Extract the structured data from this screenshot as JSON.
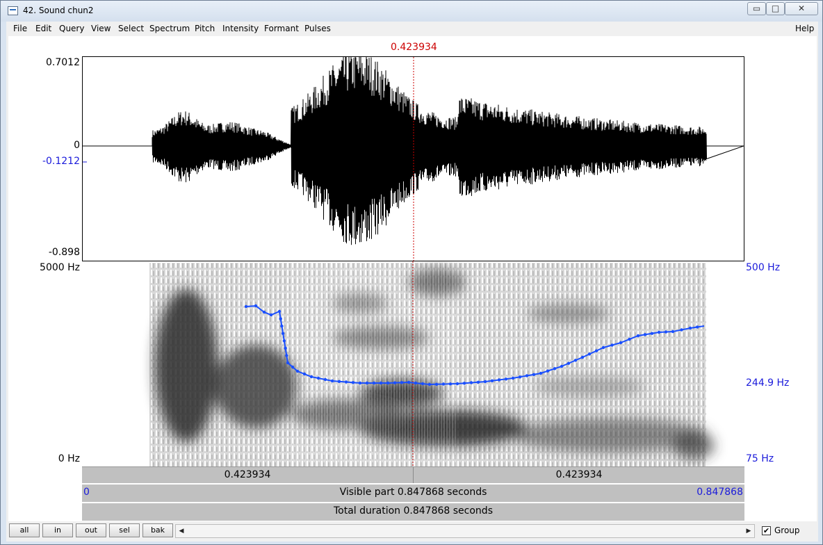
{
  "window": {
    "title": "42. Sound chun2",
    "minimize_glyph": "▭",
    "maximize_glyph": "□",
    "close_glyph": "✕"
  },
  "menu": {
    "items": [
      "File",
      "Edit",
      "Query",
      "View",
      "Select",
      "Spectrum",
      "Pitch",
      "Intensity",
      "Formant",
      "Pulses"
    ],
    "help": "Help"
  },
  "cursor": {
    "time": "0.423934",
    "color": "#cc0000"
  },
  "waveform": {
    "y_max": "0.7012",
    "y_zero": "0",
    "y_cursor_value": "-0.1212",
    "y_min": "-0.898"
  },
  "spectrogram": {
    "freq_max": "5000 Hz",
    "freq_min": "0 Hz",
    "pitch_max": "500 Hz",
    "pitch_cursor": "244.9 Hz",
    "pitch_min": "75 Hz",
    "pitch_color": "#1a4fff"
  },
  "selection_bar": {
    "left": "0.423934",
    "right": "0.423934"
  },
  "visible_bar": {
    "start": "0",
    "label": "Visible part 0.847868 seconds",
    "end": "0.847868"
  },
  "total_bar": {
    "label": "Total duration 0.847868 seconds"
  },
  "bottom": {
    "buttons": [
      "all",
      "in",
      "out",
      "sel",
      "bak"
    ],
    "scroll_left": "◀",
    "scroll_right": "▶",
    "group_checked": "✔",
    "group_label": "Group"
  }
}
